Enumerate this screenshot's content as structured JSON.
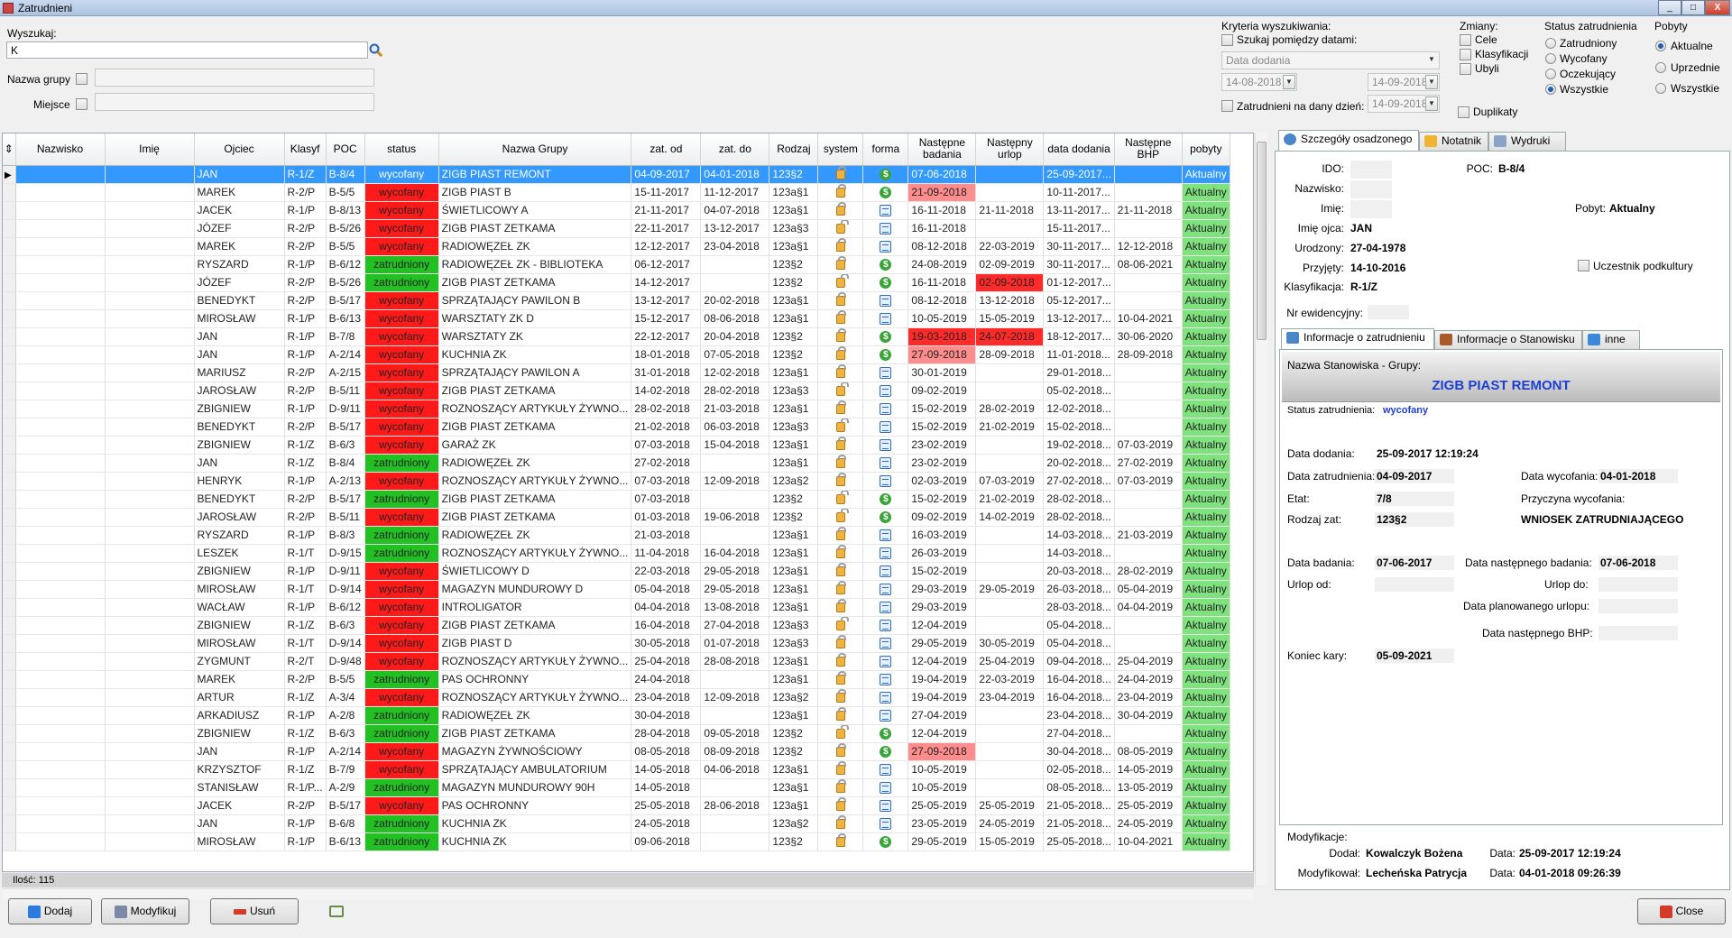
{
  "window": {
    "title": "Zatrudnieni",
    "min": "_",
    "max": "□",
    "close": "X"
  },
  "search": {
    "label": "Wyszukaj:",
    "value": "K",
    "group_label": "Nazwa grupy",
    "place_label": "Miejsce"
  },
  "criteria": {
    "title": "Kryteria wyszukiwania:",
    "between_dates": "Szukaj pomiędzy datami:",
    "date_field": "Data dodania",
    "date_from": "14-08-2018",
    "date_to": "14-09-2018",
    "employed_on_day": "Zatrudnieni na dany dzień:",
    "day_value": "14-09-2018"
  },
  "changes": {
    "title": "Zmiany:",
    "cells": "Cele",
    "classifications": "Klasyfikacji",
    "departed": "Ubyli",
    "duplicates": "Duplikaty"
  },
  "employment_status": {
    "title": "Status zatrudnienia",
    "options": [
      "Zatrudniony",
      "Wycofany",
      "Oczekujący",
      "Wszystkie"
    ],
    "selected": "Wszystkie"
  },
  "stays": {
    "title": "Pobyty",
    "options": [
      "Aktualne",
      "Uprzednie",
      "Wszystkie"
    ],
    "selected": "Aktualne"
  },
  "columns": [
    "Nazwisko",
    "Imię",
    "Ojciec",
    "Klasyf",
    "POC",
    "status",
    "Nazwa Grupy",
    "zat. od",
    "zat. do",
    "Rodzaj",
    "system",
    "forma",
    "Następne badania",
    "Następny urlop",
    "data dodania",
    "Następne BHP",
    "pobyty"
  ],
  "rows": [
    [
      "",
      "",
      "JAN",
      "R-1/Z",
      "B-8/4",
      "wycofany",
      "ZIGB PIAST REMONT",
      "04-09-2017",
      "04-01-2018",
      "123§2",
      "lock",
      "dollar",
      "07-06-2018",
      "",
      "25-09-2017...",
      "",
      "Aktualny",
      "",
      ""
    ],
    [
      "",
      "",
      "MAREK",
      "R-2/P",
      "B-5/5",
      "wycofany",
      "ZIGB PIAST B",
      "15-11-2017",
      "11-12-2017",
      "123a§1",
      "lock",
      "dollar",
      "21-09-2018",
      "",
      "10-11-2017...",
      "",
      "Aktualny",
      "red",
      ""
    ],
    [
      "",
      "",
      "JACEK",
      "R-1/P",
      "B-8/13",
      "wycofany",
      "ŚWIETLICOWY A",
      "21-11-2017",
      "04-07-2018",
      "123a§1",
      "lock",
      "doc",
      "16-11-2018",
      "21-11-2018",
      "13-11-2017...",
      "21-11-2018",
      "Aktualny",
      "",
      ""
    ],
    [
      "",
      "",
      "JÓZEF",
      "R-2/P",
      "B-5/26",
      "wycofany",
      "ZIGB PIAST ZETKAMA",
      "22-11-2017",
      "13-12-2017",
      "123a§3",
      "lockopen",
      "doc",
      "16-11-2018",
      "",
      "15-11-2017...",
      "",
      "Aktualny",
      "",
      ""
    ],
    [
      "",
      "",
      "MAREK",
      "R-2/P",
      "B-5/5",
      "wycofany",
      "RADIOWĘZEŁ ZK",
      "12-12-2017",
      "23-04-2018",
      "123a§1",
      "lock",
      "doc",
      "08-12-2018",
      "22-03-2019",
      "30-11-2017...",
      "12-12-2018",
      "Aktualny",
      "",
      ""
    ],
    [
      "",
      "",
      "RYSZARD",
      "R-1/P",
      "B-6/12",
      "zatrudniony",
      "RADIOWĘZEŁ ZK - BIBLIOTEKA",
      "06-12-2017",
      "",
      "123§2",
      "lock",
      "dollar",
      "24-08-2019",
      "02-09-2019",
      "30-11-2017...",
      "08-06-2021",
      "Aktualny",
      "",
      ""
    ],
    [
      "",
      "",
      "JÓZEF",
      "R-2/P",
      "B-5/26",
      "zatrudniony",
      "ZIGB PIAST ZETKAMA",
      "14-12-2017",
      "",
      "123§2",
      "lockopen",
      "dollar",
      "16-11-2018",
      "02-09-2018",
      "01-12-2017...",
      "",
      "Aktualny",
      "",
      "red2"
    ],
    [
      "",
      "",
      "BENEDYKT",
      "R-2/P",
      "B-5/17",
      "wycofany",
      "SPRZĄTAJĄCY PAWILON B",
      "13-12-2017",
      "20-02-2018",
      "123a§1",
      "lock",
      "doc",
      "08-12-2018",
      "13-12-2018",
      "05-12-2017...",
      "",
      "Aktualny",
      "",
      ""
    ],
    [
      "",
      "",
      "MIROSŁAW",
      "R-1/P",
      "B-6/13",
      "wycofany",
      "WARSZTATY ZK D",
      "15-12-2017",
      "08-06-2018",
      "123a§1",
      "lock",
      "doc",
      "10-05-2019",
      "15-05-2019",
      "13-12-2017...",
      "10-04-2021",
      "Aktualny",
      "",
      ""
    ],
    [
      "",
      "",
      "JAN",
      "R-1/P",
      "B-7/8",
      "wycofany",
      "WARSZTATY ZK",
      "22-12-2017",
      "20-04-2018",
      "123§2",
      "lock",
      "dollar",
      "19-03-2018",
      "24-07-2018",
      "18-12-2017...",
      "30-06-2020",
      "Aktualny",
      "red2",
      "red2"
    ],
    [
      "",
      "",
      "JAN",
      "R-1/P",
      "A-2/14",
      "wycofany",
      "KUCHNIA ZK",
      "18-01-2018",
      "07-05-2018",
      "123§2",
      "lock",
      "dollar",
      "27-09-2018",
      "28-09-2018",
      "11-01-2018...",
      "28-09-2018",
      "Aktualny",
      "red",
      ""
    ],
    [
      "",
      "",
      "MARIUSZ",
      "R-2/P",
      "A-2/15",
      "wycofany",
      "SPRZĄTAJĄCY PAWILON A",
      "31-01-2018",
      "12-02-2018",
      "123a§1",
      "lock",
      "doc",
      "30-01-2019",
      "",
      "29-01-2018...",
      "",
      "Aktualny",
      "",
      ""
    ],
    [
      "",
      "",
      "JAROSŁAW",
      "R-2/P",
      "B-5/11",
      "wycofany",
      "ZIGB PIAST ZETKAMA",
      "14-02-2018",
      "28-02-2018",
      "123a§3",
      "lockopen",
      "doc",
      "09-02-2019",
      "",
      "05-02-2018...",
      "",
      "Aktualny",
      "",
      ""
    ],
    [
      "",
      "",
      "ZBIGNIEW",
      "R-1/P",
      "D-9/11",
      "wycofany",
      "ROZNOSZĄCY ARTYKUŁY ŻYWNO...",
      "28-02-2018",
      "21-03-2018",
      "123a§1",
      "lock",
      "doc",
      "15-02-2019",
      "28-02-2019",
      "12-02-2018...",
      "",
      "Aktualny",
      "",
      ""
    ],
    [
      "",
      "",
      "BENEDYKT",
      "R-2/P",
      "B-5/17",
      "wycofany",
      "ZIGB PIAST ZETKAMA",
      "21-02-2018",
      "06-03-2018",
      "123a§3",
      "lockopen",
      "doc",
      "15-02-2019",
      "21-02-2019",
      "15-02-2018...",
      "",
      "Aktualny",
      "",
      ""
    ],
    [
      "",
      "",
      "ZBIGNIEW",
      "R-1/Z",
      "B-6/3",
      "wycofany",
      "GARAŻ ZK",
      "07-03-2018",
      "15-04-2018",
      "123a§1",
      "lock",
      "doc",
      "23-02-2019",
      "",
      "19-02-2018...",
      "07-03-2019",
      "Aktualny",
      "",
      ""
    ],
    [
      "",
      "",
      "JAN",
      "R-1/Z",
      "B-8/4",
      "zatrudniony",
      "RADIOWĘZEŁ ZK",
      "27-02-2018",
      "",
      "123a§1",
      "lock",
      "doc",
      "23-02-2019",
      "",
      "20-02-2018...",
      "27-02-2019",
      "Aktualny",
      "",
      ""
    ],
    [
      "",
      "",
      "HENRYK",
      "R-1/P",
      "A-2/13",
      "wycofany",
      "ROZNOSZĄCY ARTYKUŁY ŻYWNO...",
      "07-03-2018",
      "12-09-2018",
      "123a§2",
      "lock",
      "doc",
      "02-03-2019",
      "07-03-2019",
      "27-02-2018...",
      "07-03-2019",
      "Aktualny",
      "",
      ""
    ],
    [
      "",
      "",
      "BENEDYKT",
      "R-2/P",
      "B-5/17",
      "zatrudniony",
      "ZIGB PIAST ZETKAMA",
      "07-03-2018",
      "",
      "123§2",
      "lockopen",
      "dollar",
      "15-02-2019",
      "21-02-2019",
      "28-02-2018...",
      "",
      "Aktualny",
      "",
      ""
    ],
    [
      "",
      "",
      "JAROSŁAW",
      "R-2/P",
      "B-5/11",
      "wycofany",
      "ZIGB PIAST ZETKAMA",
      "01-03-2018",
      "19-06-2018",
      "123§2",
      "lockopen",
      "dollar",
      "09-02-2019",
      "14-02-2019",
      "28-02-2018...",
      "",
      "Aktualny",
      "",
      ""
    ],
    [
      "",
      "",
      "RYSZARD",
      "R-1/P",
      "B-8/3",
      "zatrudniony",
      "RADIOWĘZEŁ ZK",
      "21-03-2018",
      "",
      "123a§1",
      "lock",
      "doc",
      "16-03-2019",
      "",
      "14-03-2018...",
      "21-03-2019",
      "Aktualny",
      "",
      ""
    ],
    [
      "",
      "",
      "LESZEK",
      "R-1/T",
      "D-9/15",
      "zatrudniony",
      "ROZNOSZĄCY ARTYKUŁY ŻYWNO...",
      "11-04-2018",
      "16-04-2018",
      "123a§1",
      "lock",
      "doc",
      "26-03-2019",
      "",
      "14-03-2018...",
      "",
      "Aktualny",
      "",
      ""
    ],
    [
      "",
      "",
      "ZBIGNIEW",
      "R-1/P",
      "D-9/11",
      "wycofany",
      "ŚWIETLICOWY D",
      "22-03-2018",
      "29-05-2018",
      "123a§1",
      "lock",
      "doc",
      "15-02-2019",
      "",
      "20-03-2018...",
      "28-02-2019",
      "Aktualny",
      "",
      ""
    ],
    [
      "",
      "",
      "MIROSŁAW",
      "R-1/T",
      "D-9/14",
      "wycofany",
      "MAGAZYN MUNDUROWY D",
      "05-04-2018",
      "29-05-2018",
      "123a§1",
      "lock",
      "doc",
      "29-03-2019",
      "29-05-2019",
      "26-03-2018...",
      "05-04-2019",
      "Aktualny",
      "",
      ""
    ],
    [
      "",
      "",
      "WACŁAW",
      "R-1/P",
      "B-6/12",
      "wycofany",
      "INTROLIGATOR",
      "04-04-2018",
      "13-08-2018",
      "123a§1",
      "lock",
      "doc",
      "29-03-2019",
      "",
      "28-03-2018...",
      "04-04-2019",
      "Aktualny",
      "",
      ""
    ],
    [
      "",
      "",
      "ZBIGNIEW",
      "R-1/Z",
      "B-6/3",
      "wycofany",
      "ZIGB PIAST ZETKAMA",
      "16-04-2018",
      "27-04-2018",
      "123a§3",
      "lockopen",
      "doc",
      "12-04-2019",
      "",
      "05-04-2018...",
      "",
      "Aktualny",
      "",
      ""
    ],
    [
      "",
      "",
      "MIROSŁAW",
      "R-1/T",
      "D-9/14",
      "wycofany",
      "ZIGB PIAST D",
      "30-05-2018",
      "01-07-2018",
      "123a§3",
      "lock",
      "doc",
      "29-05-2019",
      "30-05-2019",
      "05-04-2018...",
      "",
      "Aktualny",
      "",
      ""
    ],
    [
      "",
      "",
      "ZYGMUNT",
      "R-2/T",
      "D-9/48",
      "wycofany",
      "ROZNOSZĄCY ARTYKUŁY ŻYWNO...",
      "25-04-2018",
      "28-08-2018",
      "123a§1",
      "lock",
      "doc",
      "12-04-2019",
      "25-04-2019",
      "09-04-2018...",
      "25-04-2019",
      "Aktualny",
      "",
      ""
    ],
    [
      "",
      "",
      "MAREK",
      "R-2/P",
      "B-5/5",
      "zatrudniony",
      "PAS OCHRONNY",
      "24-04-2018",
      "",
      "123a§1",
      "lock",
      "doc",
      "19-04-2019",
      "22-03-2019",
      "16-04-2018...",
      "24-04-2019",
      "Aktualny",
      "",
      ""
    ],
    [
      "",
      "",
      "ARTUR",
      "R-1/Z",
      "A-3/4",
      "wycofany",
      "ROZNOSZĄCY ARTYKUŁY ŻYWNO...",
      "23-04-2018",
      "12-09-2018",
      "123a§2",
      "lock",
      "doc",
      "19-04-2019",
      "23-04-2019",
      "16-04-2018...",
      "23-04-2019",
      "Aktualny",
      "",
      ""
    ],
    [
      "",
      "",
      "ARKADIUSZ",
      "R-1/P",
      "A-2/8",
      "zatrudniony",
      "RADIOWĘZEŁ ZK",
      "30-04-2018",
      "",
      "123a§1",
      "lock",
      "doc",
      "27-04-2019",
      "",
      "23-04-2018...",
      "30-04-2019",
      "Aktualny",
      "",
      ""
    ],
    [
      "",
      "",
      "ZBIGNIEW",
      "R-1/Z",
      "B-6/3",
      "zatrudniony",
      "ZIGB PIAST ZETKAMA",
      "28-04-2018",
      "09-05-2018",
      "123§2",
      "lockopen",
      "dollar",
      "12-04-2019",
      "",
      "27-04-2018...",
      "",
      "Aktualny",
      "",
      ""
    ],
    [
      "",
      "",
      "JAN",
      "R-1/P",
      "A-2/14",
      "wycofany",
      "MAGAZYN ŻYWNOŚCIOWY",
      "08-05-2018",
      "08-09-2018",
      "123§2",
      "lock",
      "dollar",
      "27-09-2018",
      "",
      "30-04-2018...",
      "08-05-2019",
      "Aktualny",
      "red",
      ""
    ],
    [
      "",
      "",
      "KRZYSZTOF",
      "R-1/Z",
      "B-7/9",
      "wycofany",
      "SPRZĄTAJĄCY AMBULATORIUM",
      "14-05-2018",
      "04-06-2018",
      "123a§1",
      "lock",
      "doc",
      "10-05-2019",
      "",
      "02-05-2018...",
      "14-05-2019",
      "Aktualny",
      "",
      ""
    ],
    [
      "",
      "",
      "STANISŁAW",
      "R-1/P...",
      "A-2/9",
      "zatrudniony",
      "MAGAZYN MUNDUROWY 90H",
      "14-05-2018",
      "",
      "123a§1",
      "lock",
      "doc",
      "10-05-2019",
      "",
      "08-05-2018...",
      "13-05-2019",
      "Aktualny",
      "",
      ""
    ],
    [
      "",
      "",
      "JACEK",
      "R-2/P",
      "B-5/17",
      "wycofany",
      "PAS OCHRONNY",
      "25-05-2018",
      "28-06-2018",
      "123a§1",
      "lock",
      "doc",
      "25-05-2019",
      "25-05-2019",
      "21-05-2018...",
      "25-05-2019",
      "Aktualny",
      "",
      ""
    ],
    [
      "",
      "",
      "JAN",
      "R-1/P",
      "B-6/8",
      "zatrudniony",
      "KUCHNIA ZK",
      "24-05-2018",
      "",
      "123a§2",
      "lock",
      "doc",
      "23-05-2019",
      "24-05-2019",
      "21-05-2018...",
      "24-05-2019",
      "Aktualny",
      "",
      ""
    ],
    [
      "",
      "",
      "MIROSŁAW",
      "R-1/P",
      "B-6/13",
      "zatrudniony",
      "KUCHNIA ZK",
      "09-06-2018",
      "",
      "123§2",
      "lock",
      "dollar",
      "29-05-2019",
      "15-05-2019",
      "25-05-2018...",
      "10-04-2021",
      "Aktualny",
      "",
      ""
    ]
  ],
  "count_label": "Ilość: 115",
  "buttons": {
    "add": "Dodaj",
    "modify": "Modyfikuj",
    "delete": "Usuń",
    "close": "Close"
  },
  "tabs": {
    "details": "Szczegóły osadzonego",
    "notes": "Notatnik",
    "printouts": "Wydruki"
  },
  "details": {
    "ido_label": "IDO:",
    "poc_label": "POC:",
    "poc": "B-8/4",
    "surname_label": "Nazwisko:",
    "name_label": "Imię:",
    "stay_label": "Pobyt:",
    "stay": "Aktualny",
    "father_label": "Imię ojca:",
    "father": "JAN",
    "born_label": "Urodzony:",
    "born": "27-04-1978",
    "admitted_label": "Przyjęty:",
    "admitted": "14-10-2016",
    "subculture_label": "Uczestnik podkultury",
    "class_label": "Klasyfikacja:",
    "class": "R-1/Z",
    "record_label": "Nr ewidencyjny:"
  },
  "subtabs": {
    "employment": "Informacje o zatrudnieniu",
    "position": "Informacje o Stanowisku",
    "other": "inne"
  },
  "employment": {
    "position_label": "Nazwa Stanowiska - Grupy:",
    "position": "ZIGB PIAST REMONT",
    "status_label": "Status zatrudnienia:",
    "status": "wycofany",
    "added_label": "Data dodania:",
    "added": "25-09-2017 12:19:24",
    "employed_label": "Data zatrudnienia:",
    "employed": "04-09-2017",
    "withdrawn_label": "Data wycofania:",
    "withdrawn": "04-01-2018",
    "fte_label": "Etat:",
    "fte": "7/8",
    "reason_label": "Przyczyna wycofania:",
    "type_label": "Rodzaj zat:",
    "type": "123§2",
    "reason": "WNIOSEK ZATRUDNIAJĄCEGO",
    "exam_label": "Data badania:",
    "exam": "07-06-2017",
    "next_exam_label": "Data następnego badania:",
    "next_exam": "07-06-2018",
    "leave_from_label": "Urlop od:",
    "leave_to_label": "Urlop do:",
    "planned_leave_label": "Data planowanego urlopu:",
    "next_bhp_label": "Data następnego BHP:",
    "sentence_end_label": "Koniec kary:",
    "sentence_end": "05-09-2021"
  },
  "modifications": {
    "title": "Modyfikacje:",
    "added_by_label": "Dodał:",
    "added_by": "Kowalczyk Bożena",
    "added_date_label": "Data:",
    "added_date": "25-09-2017 12:19:24",
    "modified_by_label": "Modyfikował:",
    "modified_by": "Lecheńska Patrycja",
    "modified_date_label": "Data:",
    "modified_date": "04-01-2018 09:26:39"
  },
  "colors": {
    "selected_row": "#3399ff",
    "withdrawn": "#ff1a1a",
    "employed": "#22c022",
    "stay": "#7fe27f",
    "title_blue": "#1d3fd0"
  }
}
